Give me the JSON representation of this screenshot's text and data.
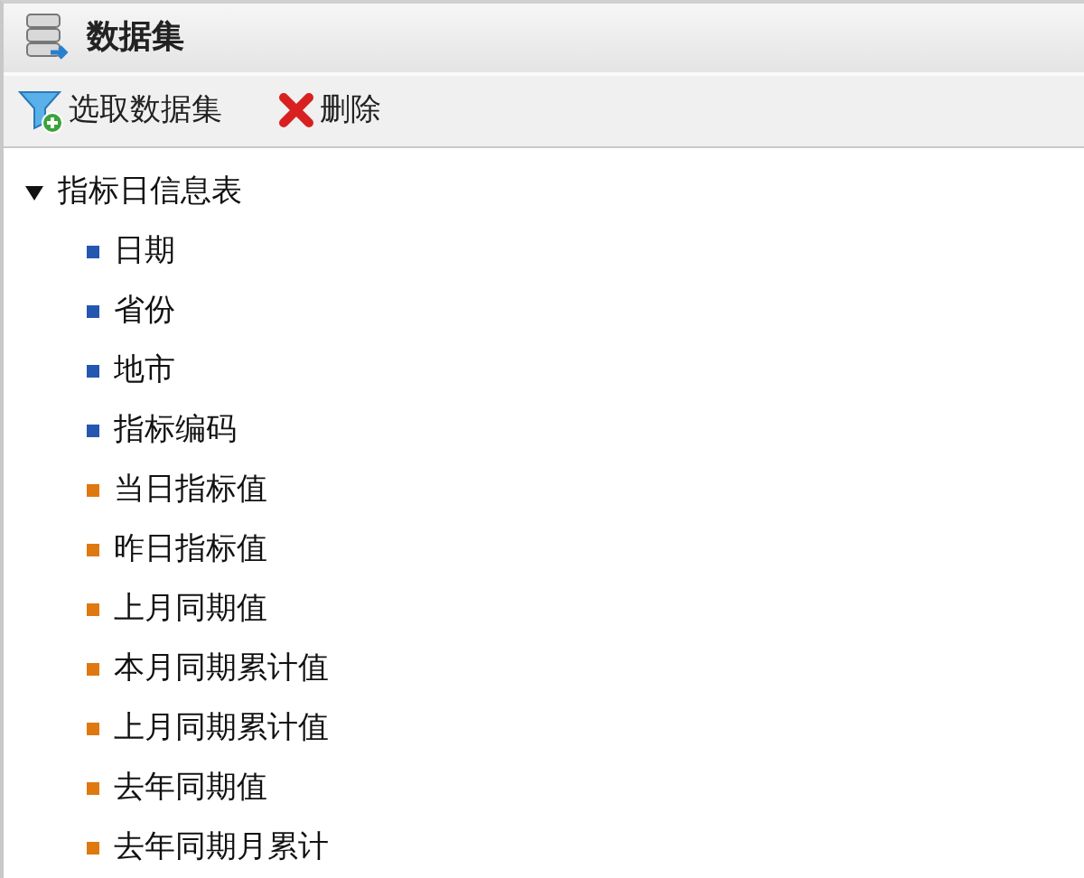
{
  "panel": {
    "title": "数据集"
  },
  "toolbar": [
    {
      "kind": "select",
      "label": "选取数据集"
    },
    {
      "kind": "delete",
      "label": "删除"
    }
  ],
  "tree": [
    {
      "label": "指标日信息表",
      "expanded": true,
      "children": [
        {
          "label": "日期",
          "color": "#2457b0"
        },
        {
          "label": "省份",
          "color": "#2457b0"
        },
        {
          "label": "地市",
          "color": "#2457b0"
        },
        {
          "label": "指标编码",
          "color": "#2457b0"
        },
        {
          "label": "当日指标值",
          "color": "#e07810"
        },
        {
          "label": "昨日指标值",
          "color": "#e07810"
        },
        {
          "label": "上月同期值",
          "color": "#e07810"
        },
        {
          "label": "本月同期累计值",
          "color": "#e07810"
        },
        {
          "label": "上月同期累计值",
          "color": "#e07810"
        },
        {
          "label": "去年同期值",
          "color": "#e07810"
        },
        {
          "label": "去年同期月累计",
          "color": "#e07810"
        }
      ]
    }
  ]
}
